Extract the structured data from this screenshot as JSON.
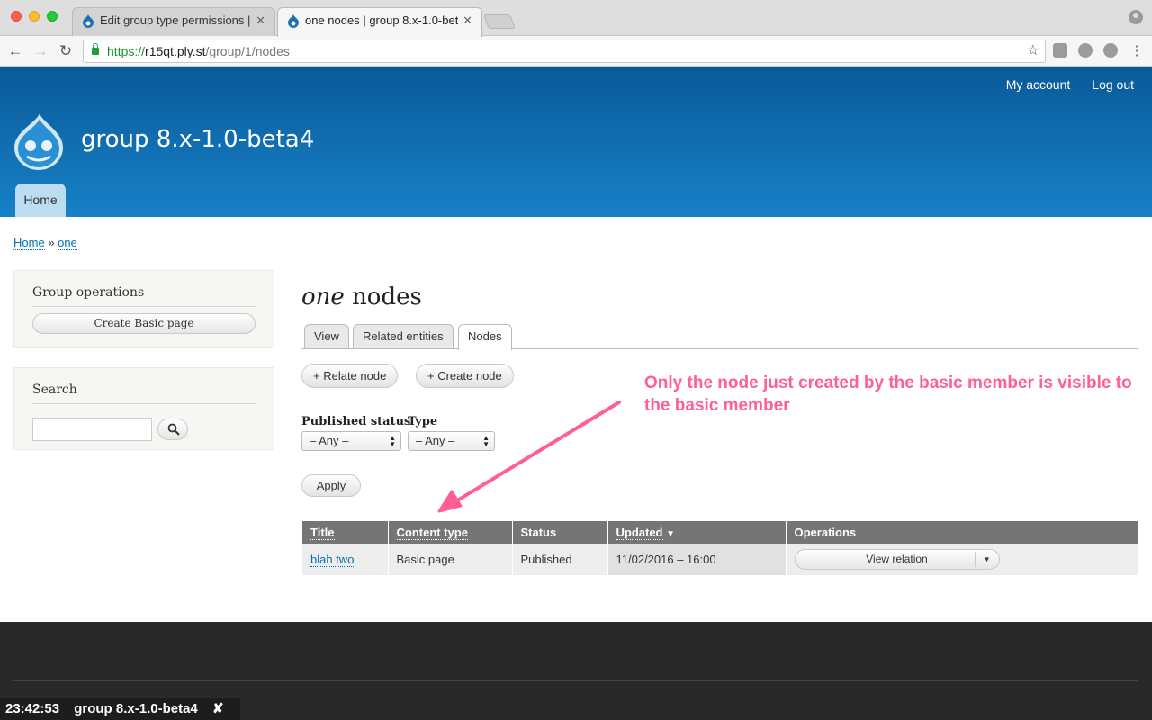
{
  "browser": {
    "tabs": [
      {
        "title": "Edit group type permissions | "
      },
      {
        "title": "one nodes | group 8.x-1.0-bet"
      }
    ],
    "url": {
      "scheme": "https://",
      "host": "r15qt.ply.st",
      "path": "/group/1/nodes"
    }
  },
  "site": {
    "name": "group 8.x-1.0-beta4",
    "secondary_menu": [
      "My account",
      "Log out"
    ],
    "main_menu": [
      "Home"
    ]
  },
  "breadcrumb": {
    "items": [
      "Home",
      "one"
    ],
    "separator": "»"
  },
  "sidebar": {
    "group_operations": {
      "title": "Group operations",
      "button": "Create Basic page"
    },
    "search": {
      "title": "Search",
      "input_value": ""
    }
  },
  "main": {
    "title_italic": "one",
    "title_rest": "nodes",
    "tabs": [
      {
        "label": "View",
        "active": false
      },
      {
        "label": "Related entities",
        "active": false
      },
      {
        "label": "Nodes",
        "active": true
      }
    ],
    "actions": [
      "+ Relate node",
      "+ Create node"
    ],
    "filters": [
      {
        "label": "Published status",
        "value": "– Any –"
      },
      {
        "label": "Type",
        "value": "– Any –"
      }
    ],
    "apply": "Apply",
    "table": {
      "columns": [
        "Title",
        "Content type",
        "Status",
        "Updated",
        "Operations"
      ],
      "sort_indicator": "▼",
      "rows": [
        {
          "title": "blah two",
          "content_type": "Basic page",
          "status": "Published",
          "updated": "11/02/2016 – 16:00",
          "operation": "View relation"
        }
      ]
    }
  },
  "annotation": {
    "text": "Only the node just created by the basic member is visible to the basic member",
    "color": "#ff5f93"
  },
  "tray": {
    "time": "23:42:53",
    "title": "group 8.x-1.0-beta4",
    "close": "✘"
  },
  "colors": {
    "header_top": "#0a5a98",
    "header_bottom": "#1781c8",
    "link": "#0071b3",
    "footer": "#292929"
  }
}
